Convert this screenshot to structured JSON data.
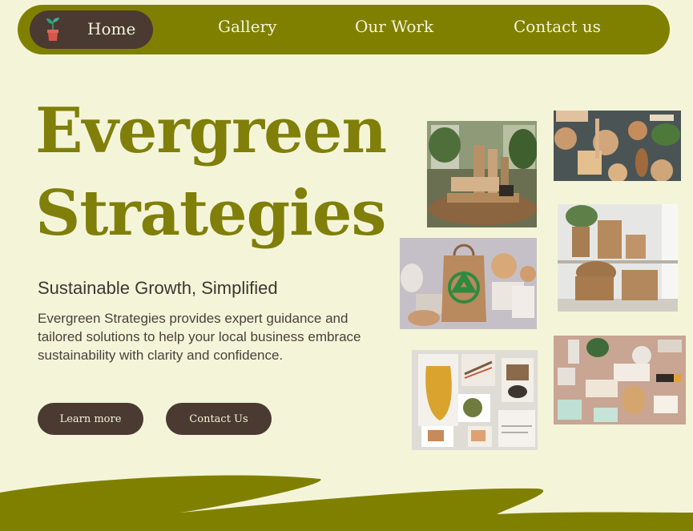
{
  "nav": {
    "items": [
      {
        "label": "Home"
      },
      {
        "label": "Gallery"
      },
      {
        "label": "Our Work"
      },
      {
        "label": "Contact us"
      }
    ]
  },
  "hero": {
    "title_line1": "Evergreen",
    "title_line2": "Strategies",
    "subtitle": "Sustainable Growth, Simplified",
    "description": "Evergreen Strategies provides expert guidance and tailored solutions to help your local business embrace sustainability with clarity and confidence.",
    "learn_more_label": "Learn more",
    "contact_label": "Contact Us"
  },
  "gallery": {
    "photos": [
      {
        "name": "bamboo kitchen products"
      },
      {
        "name": "bamboo tableware flatlay"
      },
      {
        "name": "recycle paper bag products"
      },
      {
        "name": "wicker baskets shelf"
      },
      {
        "name": "eco moodboard collage"
      },
      {
        "name": "zero waste toiletries flatlay"
      }
    ]
  },
  "colors": {
    "background": "#f4f5d8",
    "olive": "#808000",
    "brown": "#4a3a32"
  }
}
